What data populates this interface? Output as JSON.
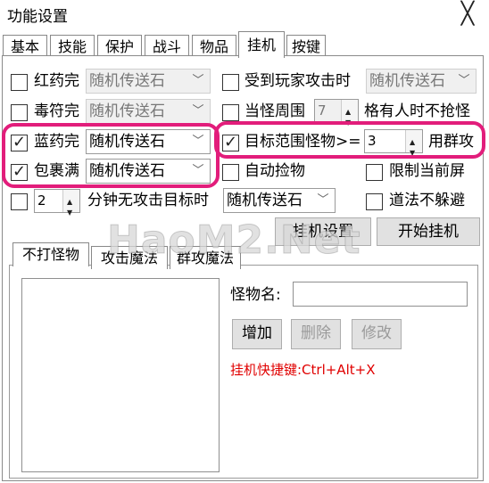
{
  "window": {
    "title": "功能设置",
    "close_glyph": "╳"
  },
  "tabs": [
    "基本",
    "技能",
    "保护",
    "战斗",
    "物品",
    "挂机",
    "按键"
  ],
  "active_tab": "挂机",
  "options": {
    "red_potion": {
      "label": "红药完",
      "checked": false,
      "combo": "随机传送石"
    },
    "poison_charm": {
      "label": "毒符完",
      "checked": false,
      "combo": "随机传送石"
    },
    "blue_potion": {
      "label": "蓝药完",
      "checked": true,
      "combo": "随机传送石"
    },
    "bag_full": {
      "label": "包裹满",
      "checked": true,
      "combo": "随机传送石"
    },
    "attacked_by_player": {
      "label": "受到玩家攻击时",
      "checked": false,
      "combo": "随机传送石"
    },
    "monsters_around": {
      "label_prefix": "当怪周围",
      "value": "7",
      "label_suffix": "格有人时不抢怪",
      "checked": false
    },
    "target_range": {
      "label": "目标范围怪物>=",
      "value": "3",
      "suffix": "用群攻",
      "checked": true
    },
    "auto_pickup": {
      "label": "自动捡物",
      "checked": false
    },
    "limit_screen": {
      "label": "限制当前屏",
      "checked": false
    },
    "no_dodge_spells": {
      "label": "道法不躲避",
      "checked": false
    },
    "no_target": {
      "value": "2",
      "label": "分钟无攻击目标时",
      "combo": "随机传送石",
      "checked": false
    }
  },
  "buttons": {
    "hangup_settings": "挂机设置",
    "start_hangup": "开始挂机"
  },
  "subtabs": [
    "不打怪物",
    "攻击魔法",
    "群攻魔法"
  ],
  "monster": {
    "name_label": "怪物名:",
    "name_value": "",
    "add": "增加",
    "delete": "删除",
    "modify": "修改",
    "hotkey": "挂机快捷键:Ctrl+Alt+X"
  },
  "watermark": "HaoM2.Net",
  "colors": {
    "highlight": "#e21d7b",
    "hotkey": "#e00000"
  }
}
